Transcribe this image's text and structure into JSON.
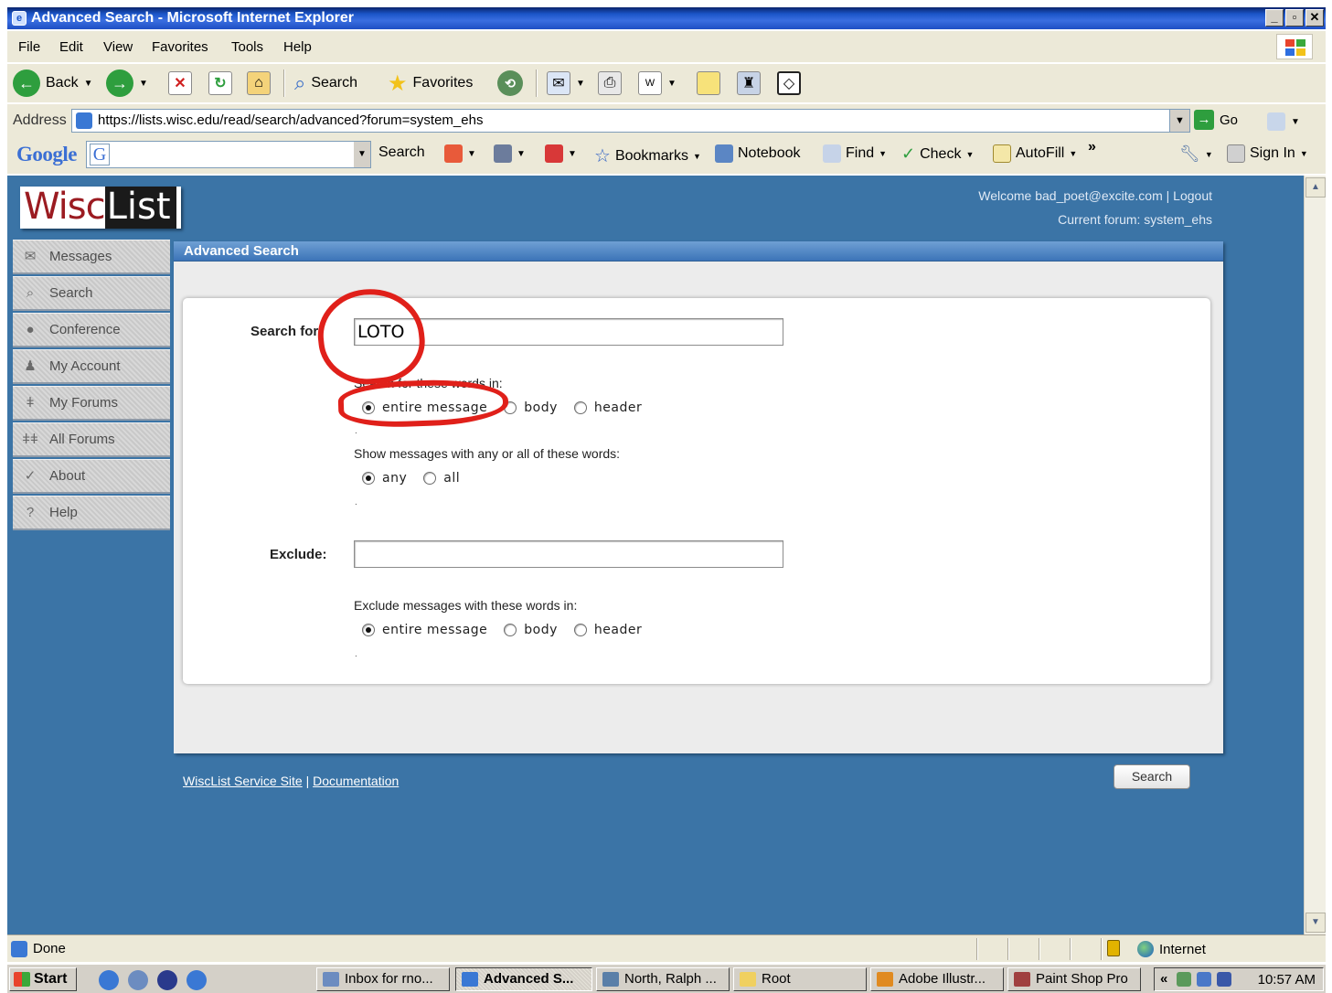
{
  "window": {
    "title": "Advanced Search - Microsoft Internet Explorer"
  },
  "menu": [
    "File",
    "Edit",
    "View",
    "Favorites",
    "Tools",
    "Help"
  ],
  "toolbar": {
    "back": "Back",
    "search": "Search",
    "favorites": "Favorites"
  },
  "address": {
    "label": "Address",
    "url": "https://lists.wisc.edu/read/search/advanced?forum=system_ehs",
    "go": "Go"
  },
  "googlebar": {
    "logo": "Google",
    "g_button": "G",
    "search": "Search",
    "bookmarks": "Bookmarks",
    "notebook": "Notebook",
    "find": "Find",
    "check": "Check",
    "autofill": "AutoFill",
    "more": "»",
    "signin": "Sign In"
  },
  "site": {
    "logo_wisc": "Wisc",
    "logo_list": "List",
    "welcome_prefix": "Welcome ",
    "user": "bad_poet@excite.com",
    "separator": " | ",
    "logout": "Logout",
    "forum_label": "Current forum: ",
    "forum": "system_ehs"
  },
  "nav": [
    {
      "label": "Messages",
      "icon": "envelope-icon"
    },
    {
      "label": "Search",
      "icon": "magnifier-icon"
    },
    {
      "label": "Conference",
      "icon": "chat-bubble-icon"
    },
    {
      "label": "My Account",
      "icon": "person-icon"
    },
    {
      "label": "My Forums",
      "icon": "single-user-icon"
    },
    {
      "label": "All Forums",
      "icon": "group-icon"
    },
    {
      "label": "About",
      "icon": "checkmark-icon"
    },
    {
      "label": "Help",
      "icon": "question-icon"
    }
  ],
  "panel": {
    "title": "Advanced Search",
    "search_for_label": "Search for:",
    "search_for_value": "LOTO",
    "search_in_label": "Search for these words in:",
    "search_in_options": [
      "entire message",
      "body",
      "header"
    ],
    "search_in_selected": "entire message",
    "match_label": "Show messages with any or all of these words:",
    "match_options": [
      "any",
      "all"
    ],
    "match_selected": "any",
    "exclude_label": "Exclude:",
    "exclude_value": "",
    "exclude_in_label": "Exclude messages with these words in:",
    "exclude_in_options": [
      "entire message",
      "body",
      "header"
    ],
    "exclude_in_selected": "entire message",
    "search_button": "Search"
  },
  "footer": {
    "link1": "WiscList Service Site",
    "separator": " | ",
    "link2": "Documentation"
  },
  "status": {
    "text": "Done",
    "zone": "Internet"
  },
  "taskbar": {
    "start": "Start",
    "tasks": [
      "Inbox for rno...",
      "Advanced S...",
      "North, Ralph ...",
      "Root",
      "Adobe Illustr...",
      "Paint Shop Pro"
    ],
    "active_task": "Advanced S...",
    "clock": "10:57 AM",
    "tray_chevron": "«"
  },
  "colors": {
    "page_bg": "#3b74a6",
    "annotation": "#e0201a",
    "logo_red": "#9b1b21"
  }
}
